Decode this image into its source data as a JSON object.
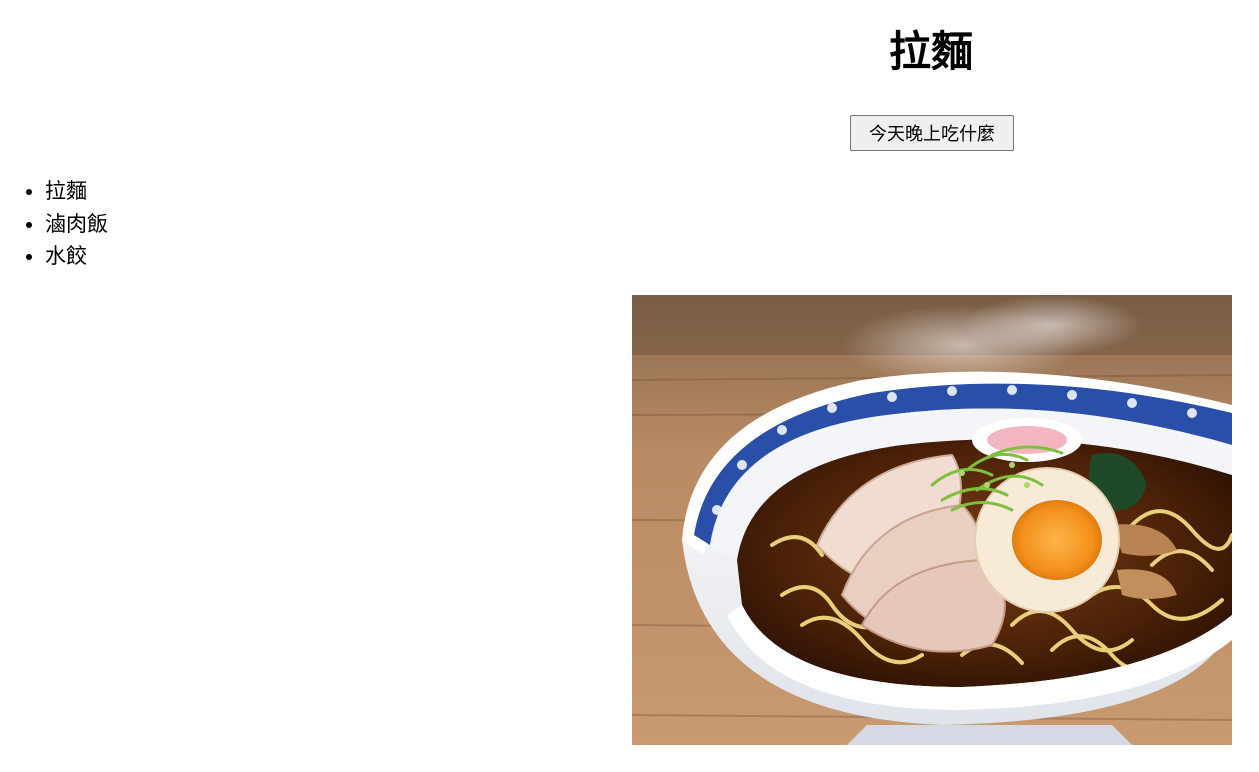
{
  "heading": "拉麵",
  "button": {
    "label": "今天晚上吃什麼"
  },
  "menu": [
    "拉麵",
    "滷肉飯",
    "水餃"
  ],
  "photo": {
    "subject": "ramen bowl with chashu pork, soft-boiled egg and scallions",
    "accent": "#2a4fa8"
  }
}
